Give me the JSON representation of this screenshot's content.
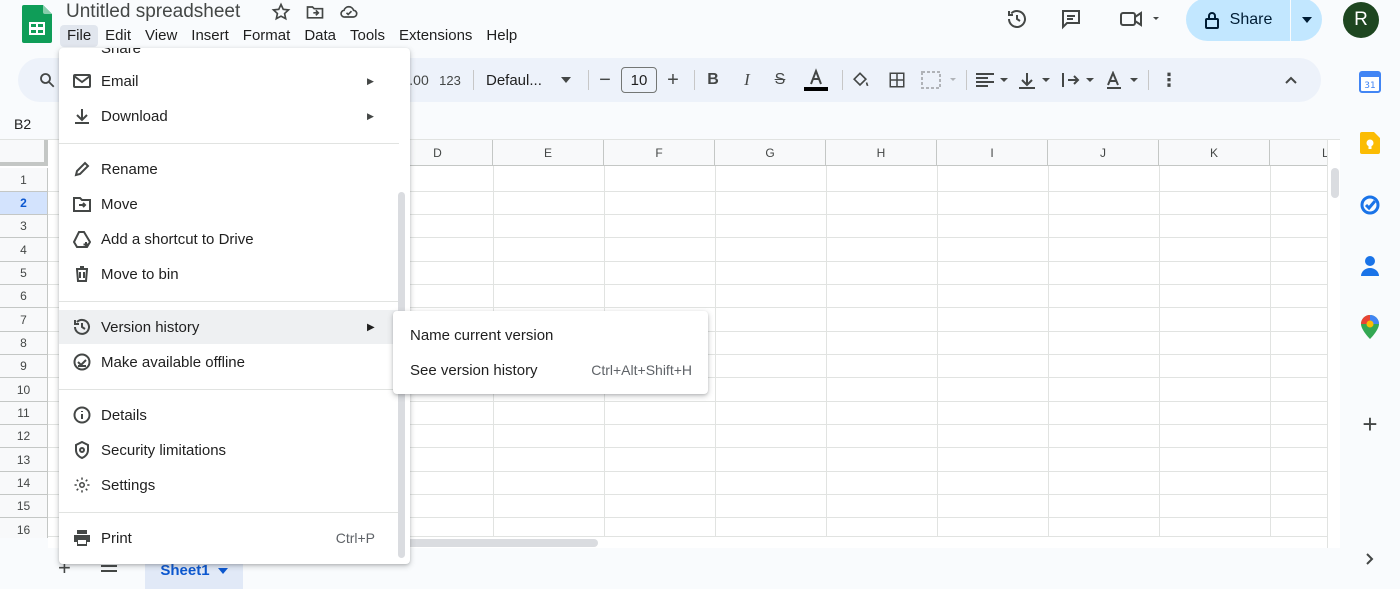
{
  "app": {
    "title": "Untitled spreadsheet",
    "brand_color": "#0f9d58",
    "accent": "#0b57d0"
  },
  "title_icons": [
    "star-icon",
    "move-folder-icon",
    "cloud-status-icon"
  ],
  "menubar": {
    "items": [
      "File",
      "Edit",
      "View",
      "Insert",
      "Format",
      "Data",
      "Tools",
      "Extensions",
      "Help"
    ],
    "active": "File"
  },
  "header": {
    "share_label": "Share",
    "avatar_initial": "R"
  },
  "toolbar": {
    "format_123": "123",
    "font": "Defaul...",
    "font_size": "10"
  },
  "namebox": "B2",
  "grid": {
    "columns": [
      "D",
      "E",
      "F",
      "G",
      "H",
      "I",
      "J",
      "K",
      "L"
    ],
    "rows": [
      "1",
      "2",
      "3",
      "4",
      "5",
      "6",
      "7",
      "8",
      "9",
      "10",
      "11",
      "12",
      "13",
      "14",
      "15",
      "16"
    ],
    "selected_row": "2"
  },
  "sheet_tab": {
    "label": "Sheet1"
  },
  "file_menu": {
    "cut_off_top": "Share",
    "items": [
      {
        "label": "Email",
        "icon": "email-icon",
        "has_submenu": true
      },
      {
        "label": "Download",
        "icon": "download-icon",
        "has_submenu": true
      },
      {
        "label": "Rename",
        "icon": "pencil-icon"
      },
      {
        "label": "Move",
        "icon": "folder-move-icon"
      },
      {
        "label": "Add a shortcut to Drive",
        "icon": "drive-shortcut-icon"
      },
      {
        "label": "Move to bin",
        "icon": "trash-icon"
      },
      {
        "label": "Version history",
        "icon": "history-icon",
        "has_submenu": true,
        "highlighted": true
      },
      {
        "label": "Make available offline",
        "icon": "offline-icon"
      },
      {
        "label": "Details",
        "icon": "info-icon"
      },
      {
        "label": "Security limitations",
        "icon": "shield-icon"
      },
      {
        "label": "Settings",
        "icon": "gear-icon"
      },
      {
        "label": "Print",
        "icon": "print-icon",
        "shortcut": "Ctrl+P"
      }
    ]
  },
  "version_submenu": {
    "items": [
      {
        "label": "Name current version"
      },
      {
        "label": "See version history",
        "shortcut": "Ctrl+Alt+Shift+H"
      }
    ]
  }
}
